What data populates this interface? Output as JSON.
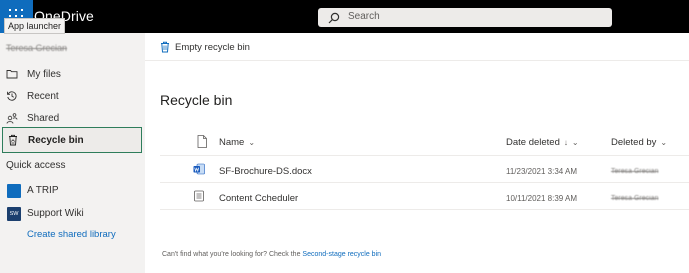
{
  "app": {
    "title": "OneDrive",
    "launcher_tooltip": "App launcher"
  },
  "search": {
    "placeholder": "Search"
  },
  "nav": {
    "user_name": "Teresa Grecian",
    "items": [
      {
        "label": "My files",
        "icon": "folder-icon"
      },
      {
        "label": "Recent",
        "icon": "clock-icon"
      },
      {
        "label": "Shared",
        "icon": "people-icon"
      },
      {
        "label": "Recycle bin",
        "icon": "recycle-bin-icon",
        "active": true
      }
    ],
    "quick_access_title": "Quick access",
    "quick_access": [
      {
        "label": "A TRIP",
        "badge": ""
      },
      {
        "label": "Support Wiki",
        "badge": "SW"
      }
    ],
    "create_library": "Create shared library"
  },
  "toolbar": {
    "empty_label": "Empty recycle bin"
  },
  "page": {
    "title": "Recycle bin"
  },
  "table": {
    "headers": {
      "name": "Name",
      "date": "Date deleted",
      "deleted_by": "Deleted by"
    },
    "rows": [
      {
        "name": "SF-Brochure-DS.docx",
        "icon": "word-doc-icon",
        "date": "11/23/2021 3:34 AM",
        "deleted_by": "Teresa Grecian"
      },
      {
        "name": "Content Ccheduler",
        "icon": "list-icon",
        "date": "10/11/2021 8:39 AM",
        "deleted_by": "Teresa Grecian"
      }
    ]
  },
  "footer": {
    "text": "Can't find what you're looking for? Check the ",
    "link": "Second-stage recycle bin"
  },
  "colors": {
    "brand": "#0f6cbd",
    "active_border": "#2e7d5b",
    "nav_bg": "#f3f2f1"
  }
}
